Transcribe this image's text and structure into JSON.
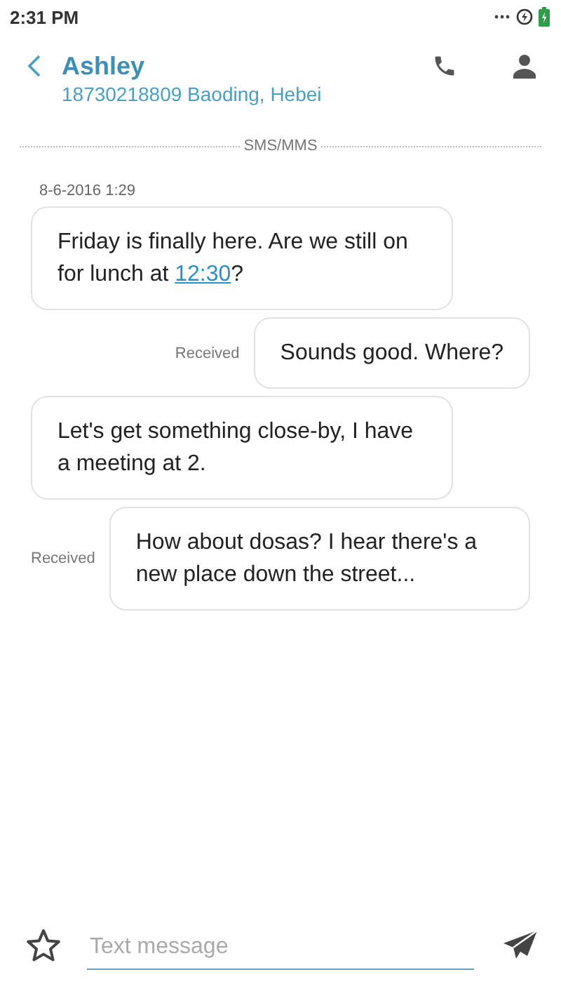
{
  "status_bar": {
    "time": "2:31 PM"
  },
  "header": {
    "contact_name": "Ashley",
    "contact_detail": "18730218809 Baoding, Hebei"
  },
  "channel_divider": "SMS/MMS",
  "timestamp": "8-6-2016 1:29",
  "messages": [
    {
      "kind": "incoming",
      "parts": [
        {
          "kind": "text",
          "text": "Friday is finally here. Are we still on for lunch at "
        },
        {
          "kind": "link",
          "text": "12:30"
        },
        {
          "kind": "text",
          "text": "?"
        }
      ]
    },
    {
      "kind": "outgoing",
      "status": "Received",
      "parts": [
        {
          "kind": "text",
          "text": "Sounds good. Where?"
        }
      ]
    },
    {
      "kind": "incoming",
      "parts": [
        {
          "kind": "text",
          "text": "Let's get something close-by, I have a meeting at 2."
        }
      ]
    },
    {
      "kind": "outgoing",
      "status": "Received",
      "parts": [
        {
          "kind": "text",
          "text": "How about dosas? I hear there's a new place down the street..."
        }
      ]
    }
  ],
  "composer": {
    "placeholder": "Text message"
  }
}
